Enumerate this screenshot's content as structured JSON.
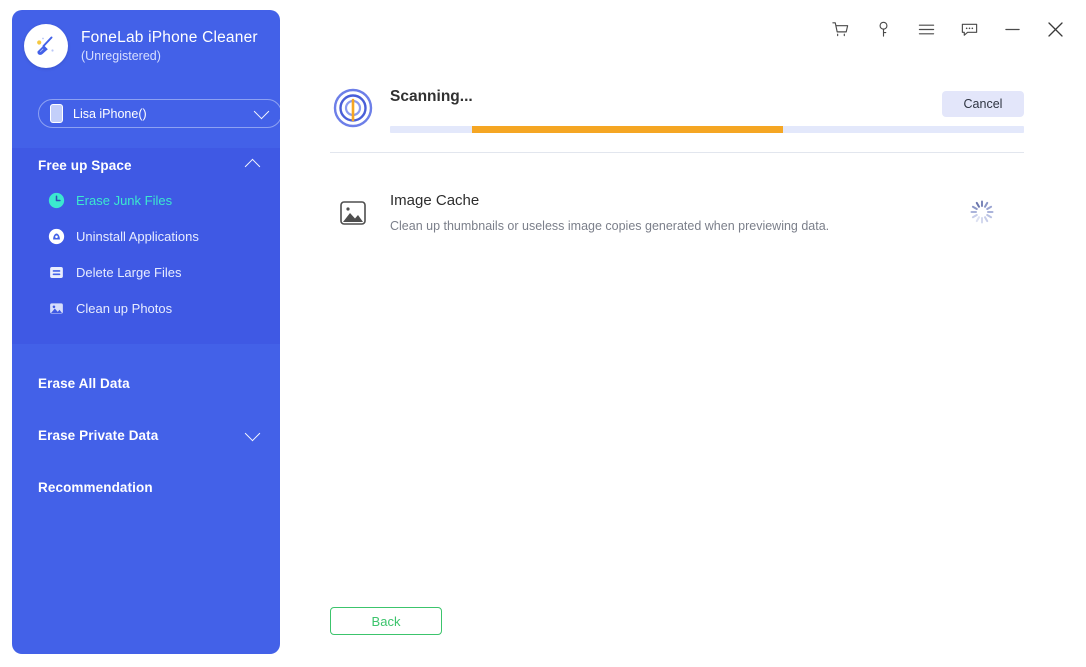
{
  "app": {
    "name": "FoneLab iPhone Cleaner",
    "registration_status": "(Unregistered)",
    "logo_icon": "broom-icon",
    "accent_blue": "#4361e8",
    "accent_teal": "#3be8cf",
    "accent_orange": "#f5a623",
    "accent_green": "#3cc46c"
  },
  "device_selector": {
    "label": "Lisa iPhone()",
    "icon": "phone-icon",
    "chevron": "chevron-down-icon"
  },
  "titlebar": {
    "icons": [
      {
        "name": "cart-icon",
        "label": "Cart"
      },
      {
        "name": "key-icon",
        "label": "Register"
      },
      {
        "name": "menu-icon",
        "label": "Menu"
      },
      {
        "name": "feedback-icon",
        "label": "Feedback"
      },
      {
        "name": "minimize-icon",
        "label": "Minimize"
      },
      {
        "name": "close-icon",
        "label": "Close"
      }
    ]
  },
  "sidebar": {
    "groups": [
      {
        "title": "Free up Space",
        "expanded": true,
        "chevron": "chevron-up-icon",
        "items": [
          {
            "label": "Erase Junk Files",
            "icon": "clock-icon",
            "active": true
          },
          {
            "label": "Uninstall Applications",
            "icon": "app-uninstall-icon",
            "active": false
          },
          {
            "label": "Delete Large Files",
            "icon": "file-lines-icon",
            "active": false
          },
          {
            "label": "Clean up Photos",
            "icon": "photo-icon",
            "active": false
          }
        ]
      },
      {
        "title": "Erase All Data",
        "expanded": false,
        "chevron": "",
        "items": []
      },
      {
        "title": "Erase Private Data",
        "expanded": false,
        "chevron": "chevron-down-icon",
        "items": []
      },
      {
        "title": "Recommendation",
        "expanded": false,
        "chevron": "",
        "items": []
      }
    ]
  },
  "main": {
    "scan": {
      "status_text": "Scanning...",
      "icon": "radar-scan-icon",
      "cancel_label": "Cancel",
      "progress": {
        "start_percent": 13,
        "width_percent": 49,
        "track_color": "#e3e8fb",
        "fill_color": "#f5a623"
      }
    },
    "results": [
      {
        "title": "Image Cache",
        "description": "Clean up thumbnails or useless image copies generated when previewing data.",
        "icon": "image-icon",
        "status_icon": "loading-spinner-icon"
      }
    ],
    "back_label": "Back"
  }
}
